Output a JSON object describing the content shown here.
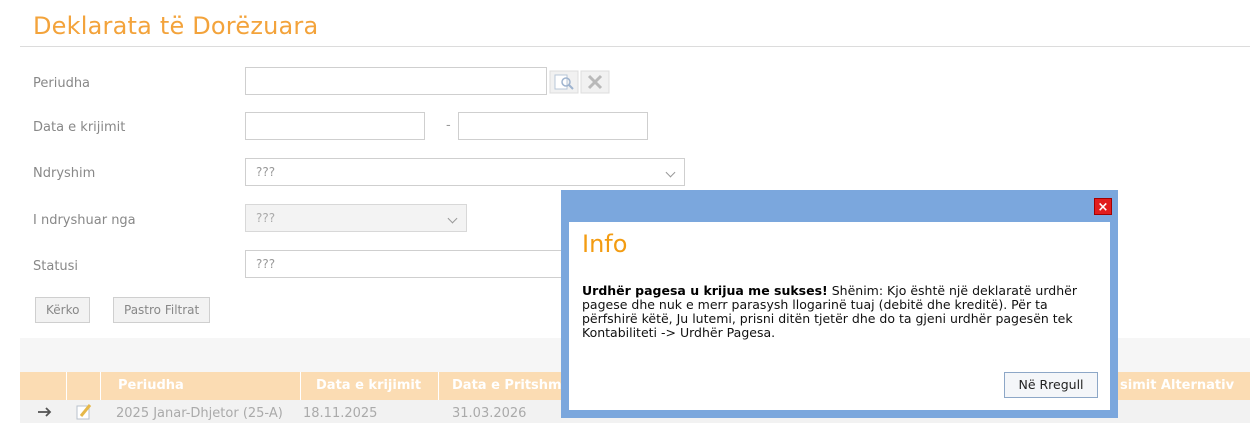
{
  "page": {
    "title": "Deklarata të Dorëzuara"
  },
  "filters": {
    "periudha_label": "Periudha",
    "data_krijimit_label": "Data e krijimit",
    "date_separator": "-",
    "ndryshim_label": "Ndryshim",
    "ndryshim_value": "???",
    "ndryshuar_nga_label": "I ndryshuar nga",
    "ndryshuar_nga_value": "???",
    "statusi_label": "Statusi",
    "statusi_value": "???"
  },
  "buttons": {
    "search": "Kërko",
    "clear_filters": "Pastro Filtrat"
  },
  "table": {
    "columns": [
      "Periudha",
      "Data e krijimit",
      "Data e Pritshm",
      "simit Alternativ"
    ],
    "rows": [
      {
        "periudha": "2025 Janar-Dhjetor (25-A)",
        "data_krijimit": "18.11.2025",
        "data_pritshme": "31.03.2026"
      }
    ]
  },
  "dialog": {
    "title": "Info",
    "message_bold": "Urdhër pagesa u krijua me sukses!",
    "message_rest": " Shënim: Kjo është një deklaratë urdhër pagese dhe nuk e merr parasysh llogarinë tuaj (debitë dhe kreditë). Për ta përfshirë këtë, Ju lutemi, prisni ditën tjetër dhe do ta gjeni urdhër pagesën tek Kontabiliteti -> Urdhër Pagesa.",
    "ok_label": "Në Rregull",
    "close_glyph": "×"
  },
  "colors": {
    "accent": "#f3a33b",
    "dialog_frame": "#7ba7dd",
    "table_header": "#fbdcb3",
    "close": "#e11d1d"
  }
}
